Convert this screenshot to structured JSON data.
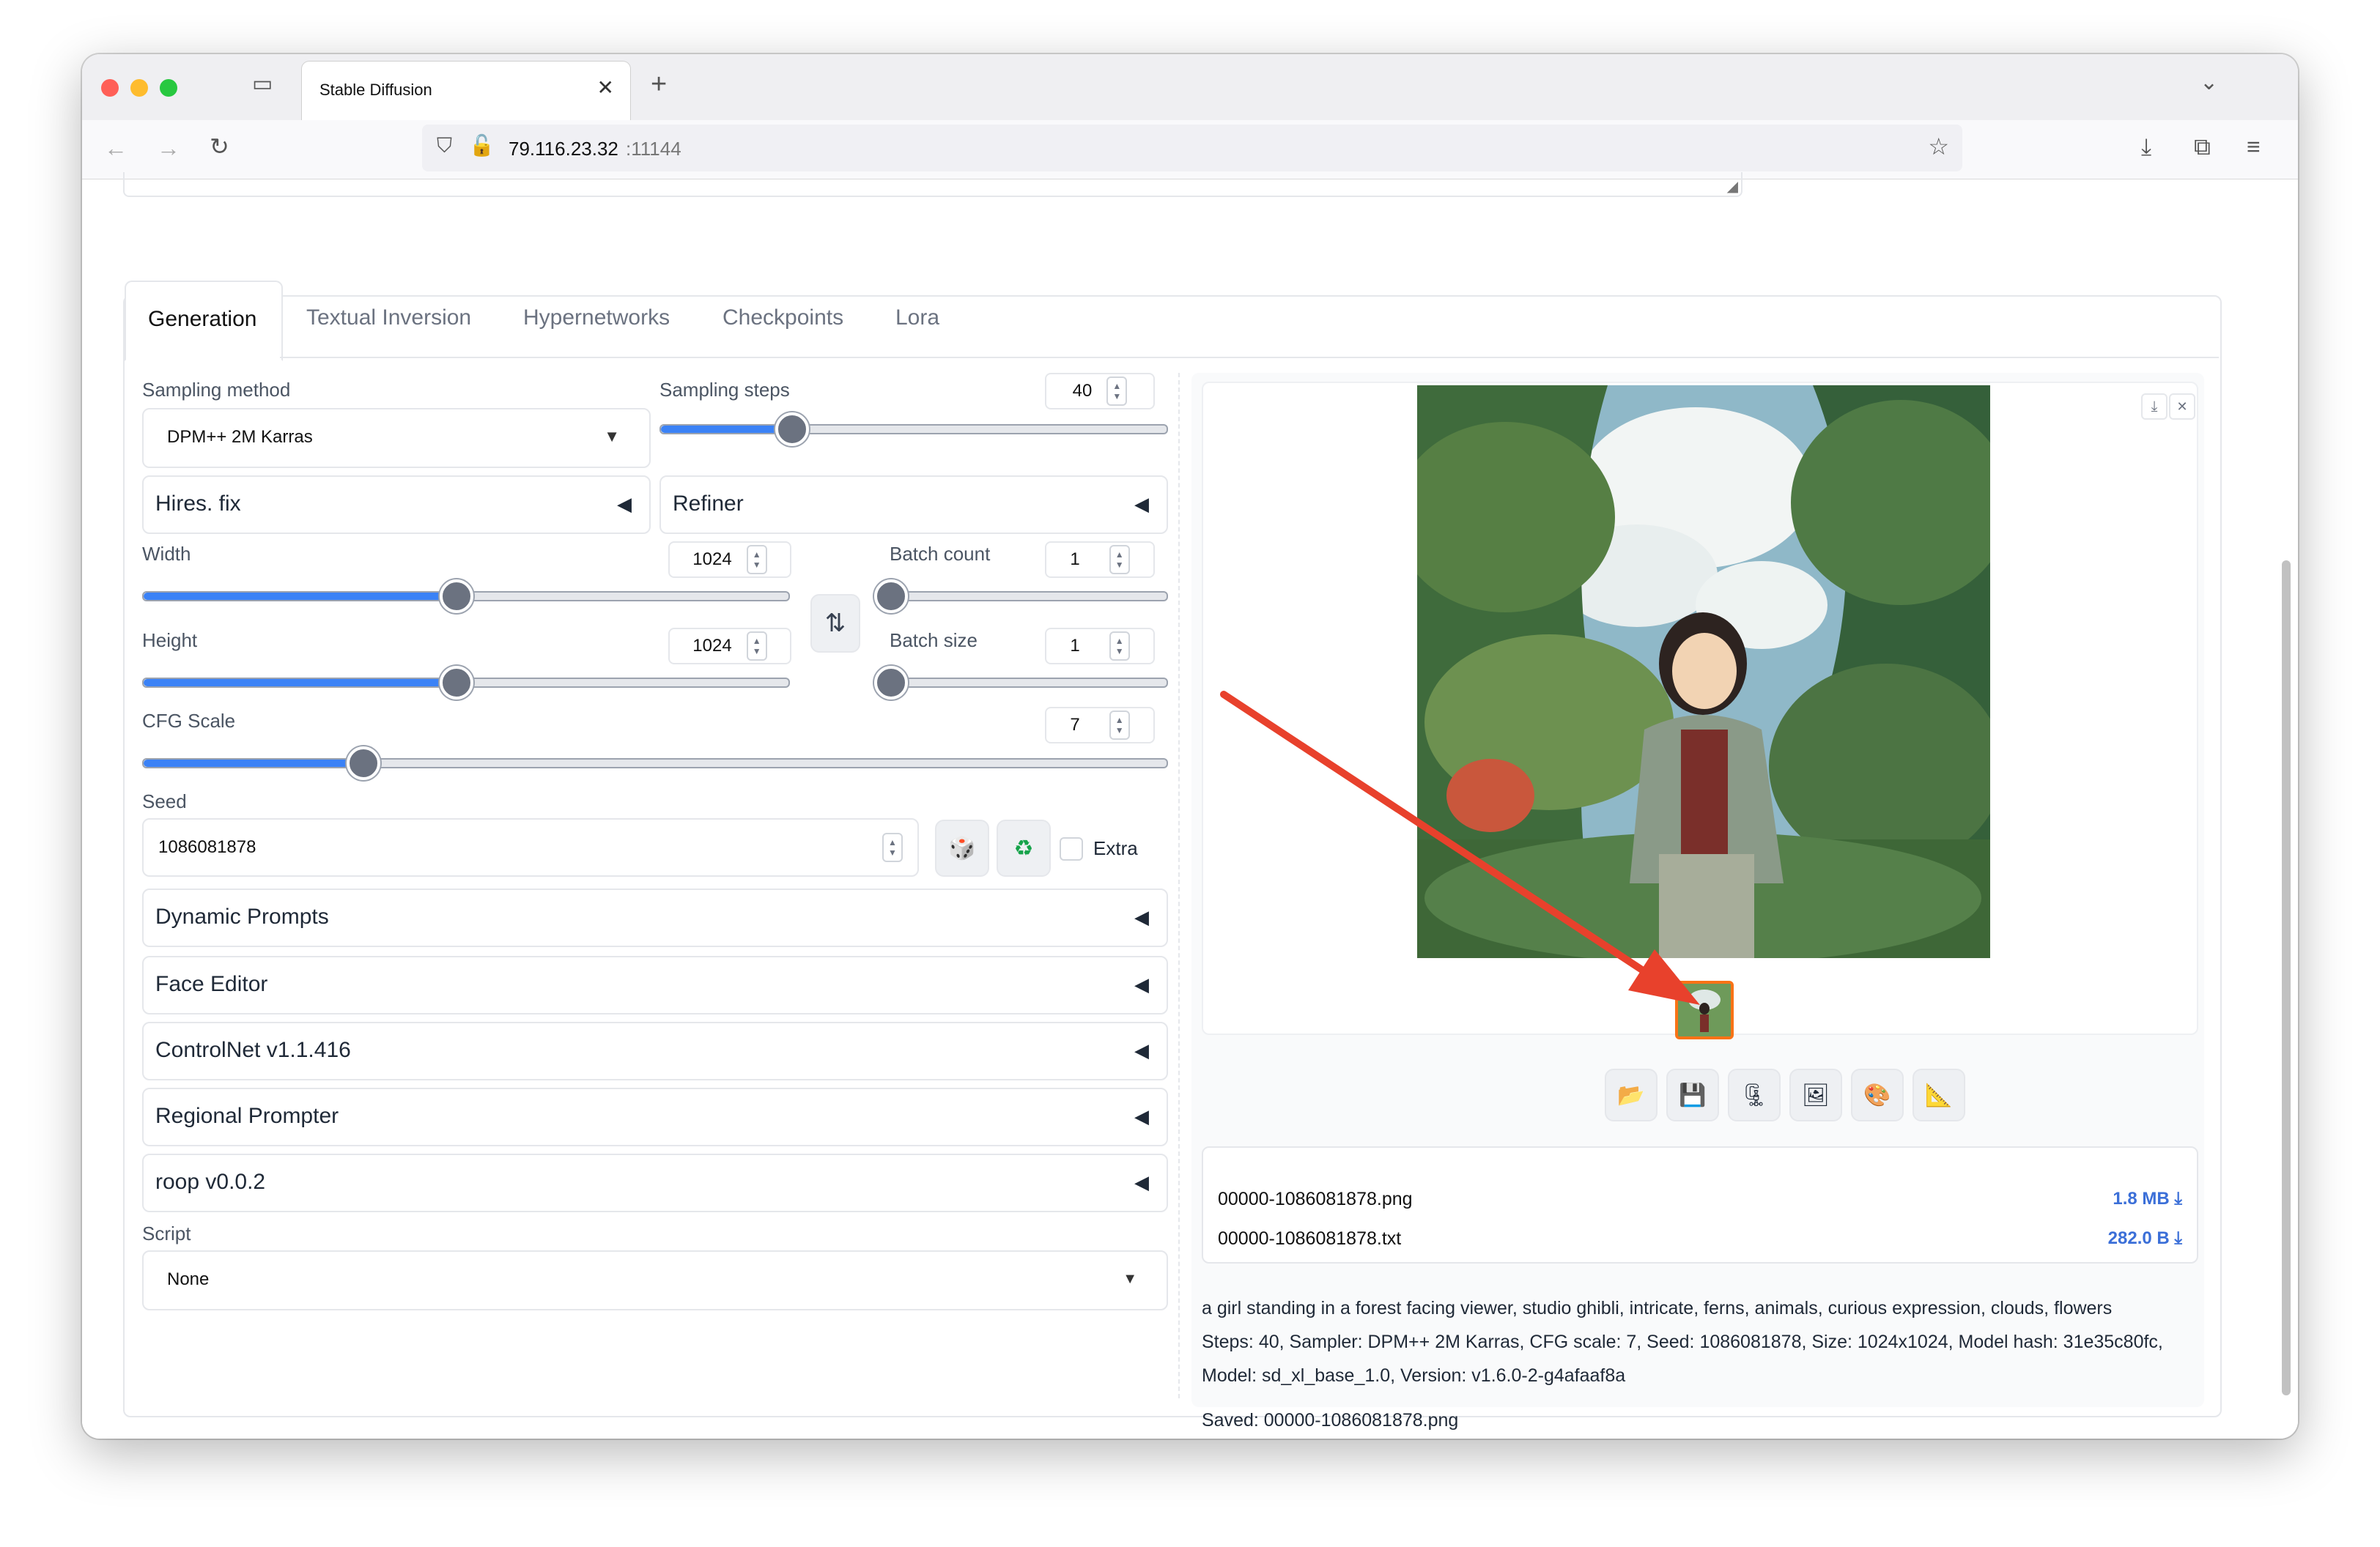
{
  "browser": {
    "tab_title": "Stable Diffusion",
    "url_host": "79.116.23.32",
    "url_port": ":11144"
  },
  "tabs": [
    "Generation",
    "Textual Inversion",
    "Hypernetworks",
    "Checkpoints",
    "Lora"
  ],
  "generation": {
    "sampling_method_label": "Sampling method",
    "sampling_method_value": "DPM++ 2M Karras",
    "sampling_steps_label": "Sampling steps",
    "sampling_steps_value": "40",
    "sampling_steps_level": 0.26,
    "hires_fix": "Hires. fix",
    "refiner": "Refiner",
    "width_label": "Width",
    "width_value": "1024",
    "width_level": 0.485,
    "height_label": "Height",
    "height_value": "1024",
    "height_level": 0.485,
    "batch_count_label": "Batch count",
    "batch_count_value": "1",
    "batch_count_level": 0,
    "batch_size_label": "Batch size",
    "batch_size_value": "1",
    "batch_size_level": 0,
    "cfg_label": "CFG Scale",
    "cfg_value": "7",
    "cfg_level": 0.215,
    "seed_label": "Seed",
    "seed_value": "1086081878",
    "extra_label": "Extra",
    "accordions": [
      "Dynamic Prompts",
      "Face Editor",
      "ControlNet v1.1.416",
      "Regional Prompter",
      "roop v0.0.2"
    ],
    "script_label": "Script",
    "script_value": "None"
  },
  "output": {
    "files": [
      {
        "name": "00000-1086081878.png",
        "size": "1.8 MB"
      },
      {
        "name": "00000-1086081878.txt",
        "size": "282.0 B"
      }
    ],
    "info_line1": "a girl standing in a forest facing viewer, studio ghibli, intricate, ferns, animals, curious expression, clouds, flowers",
    "info_line2": "Steps: 40, Sampler: DPM++ 2M Karras, CFG scale: 7, Seed: 1086081878, Size: 1024x1024, Model hash: 31e35c80fc,",
    "info_line3": "Model: sd_xl_base_1.0, Version: v1.6.0-2-g4afaaf8a",
    "saved": "Saved: 00000-1086081878.png"
  },
  "icons": {
    "swap": "⇅",
    "dice": "🎲",
    "recycle": "♻",
    "folder": "📂",
    "save": "💾",
    "zip": "🗜",
    "image": "🖼",
    "palette": "🎨",
    "triangle": "📐",
    "download": "⤓",
    "close": "✕"
  },
  "colors": {
    "accent": "#3b82f6",
    "annotation_arrow": "#e8412c",
    "file_size": "#3b6fd8"
  }
}
